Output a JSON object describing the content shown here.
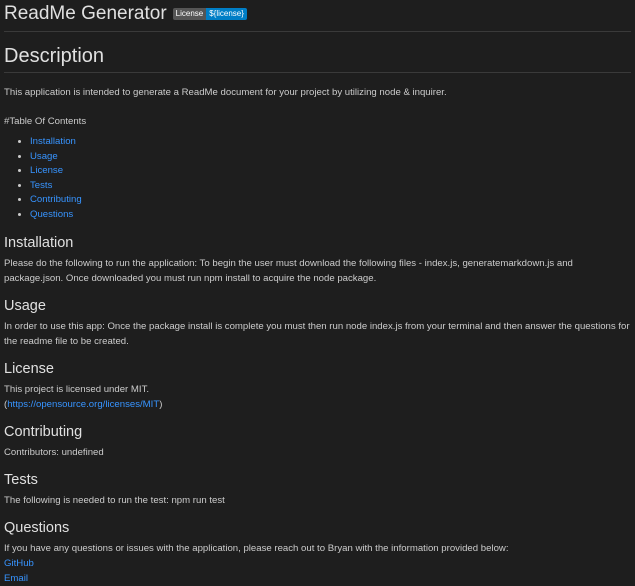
{
  "title": "ReadMe Generator",
  "badge": {
    "label": "License",
    "value": "${license}",
    "label_color": "#555555",
    "value_color": "#007ec6"
  },
  "description": {
    "heading": "Description",
    "text": "This application is intended to generate a ReadMe document for your project by utilizing node & inquirer."
  },
  "toc": {
    "heading": "#Table Of Contents",
    "items": [
      "Installation",
      "Usage",
      "License",
      "Tests",
      "Contributing",
      "Questions"
    ]
  },
  "installation": {
    "heading": "Installation",
    "text": "Please do the following to run the application: To begin the user must download the following files - index.js, generatemarkdown.js and package.json. Once downloaded you must run npm install to acquire the node package."
  },
  "usage": {
    "heading": "Usage",
    "text": "In order to use this app: Once the package install is complete you must then run node index.js from your terminal and then answer the questions for the readme file to be created."
  },
  "license": {
    "heading": "License",
    "text": "This project is licensed under MIT.",
    "link": "https://opensource.org/licenses/MIT",
    "open": "(",
    "close": ")"
  },
  "contributing": {
    "heading": "Contributing",
    "text": "Contributors: undefined"
  },
  "tests": {
    "heading": "Tests",
    "text": "The following is needed to run the test: npm run test"
  },
  "questions": {
    "heading": "Questions",
    "text": "If you have any questions or issues with the application, please reach out to Bryan with the information provided below:",
    "links": [
      "GitHub",
      "Email"
    ]
  },
  "colors": {
    "background": "#1e1e1e",
    "text": "#cccccc",
    "link": "#3794ff"
  }
}
